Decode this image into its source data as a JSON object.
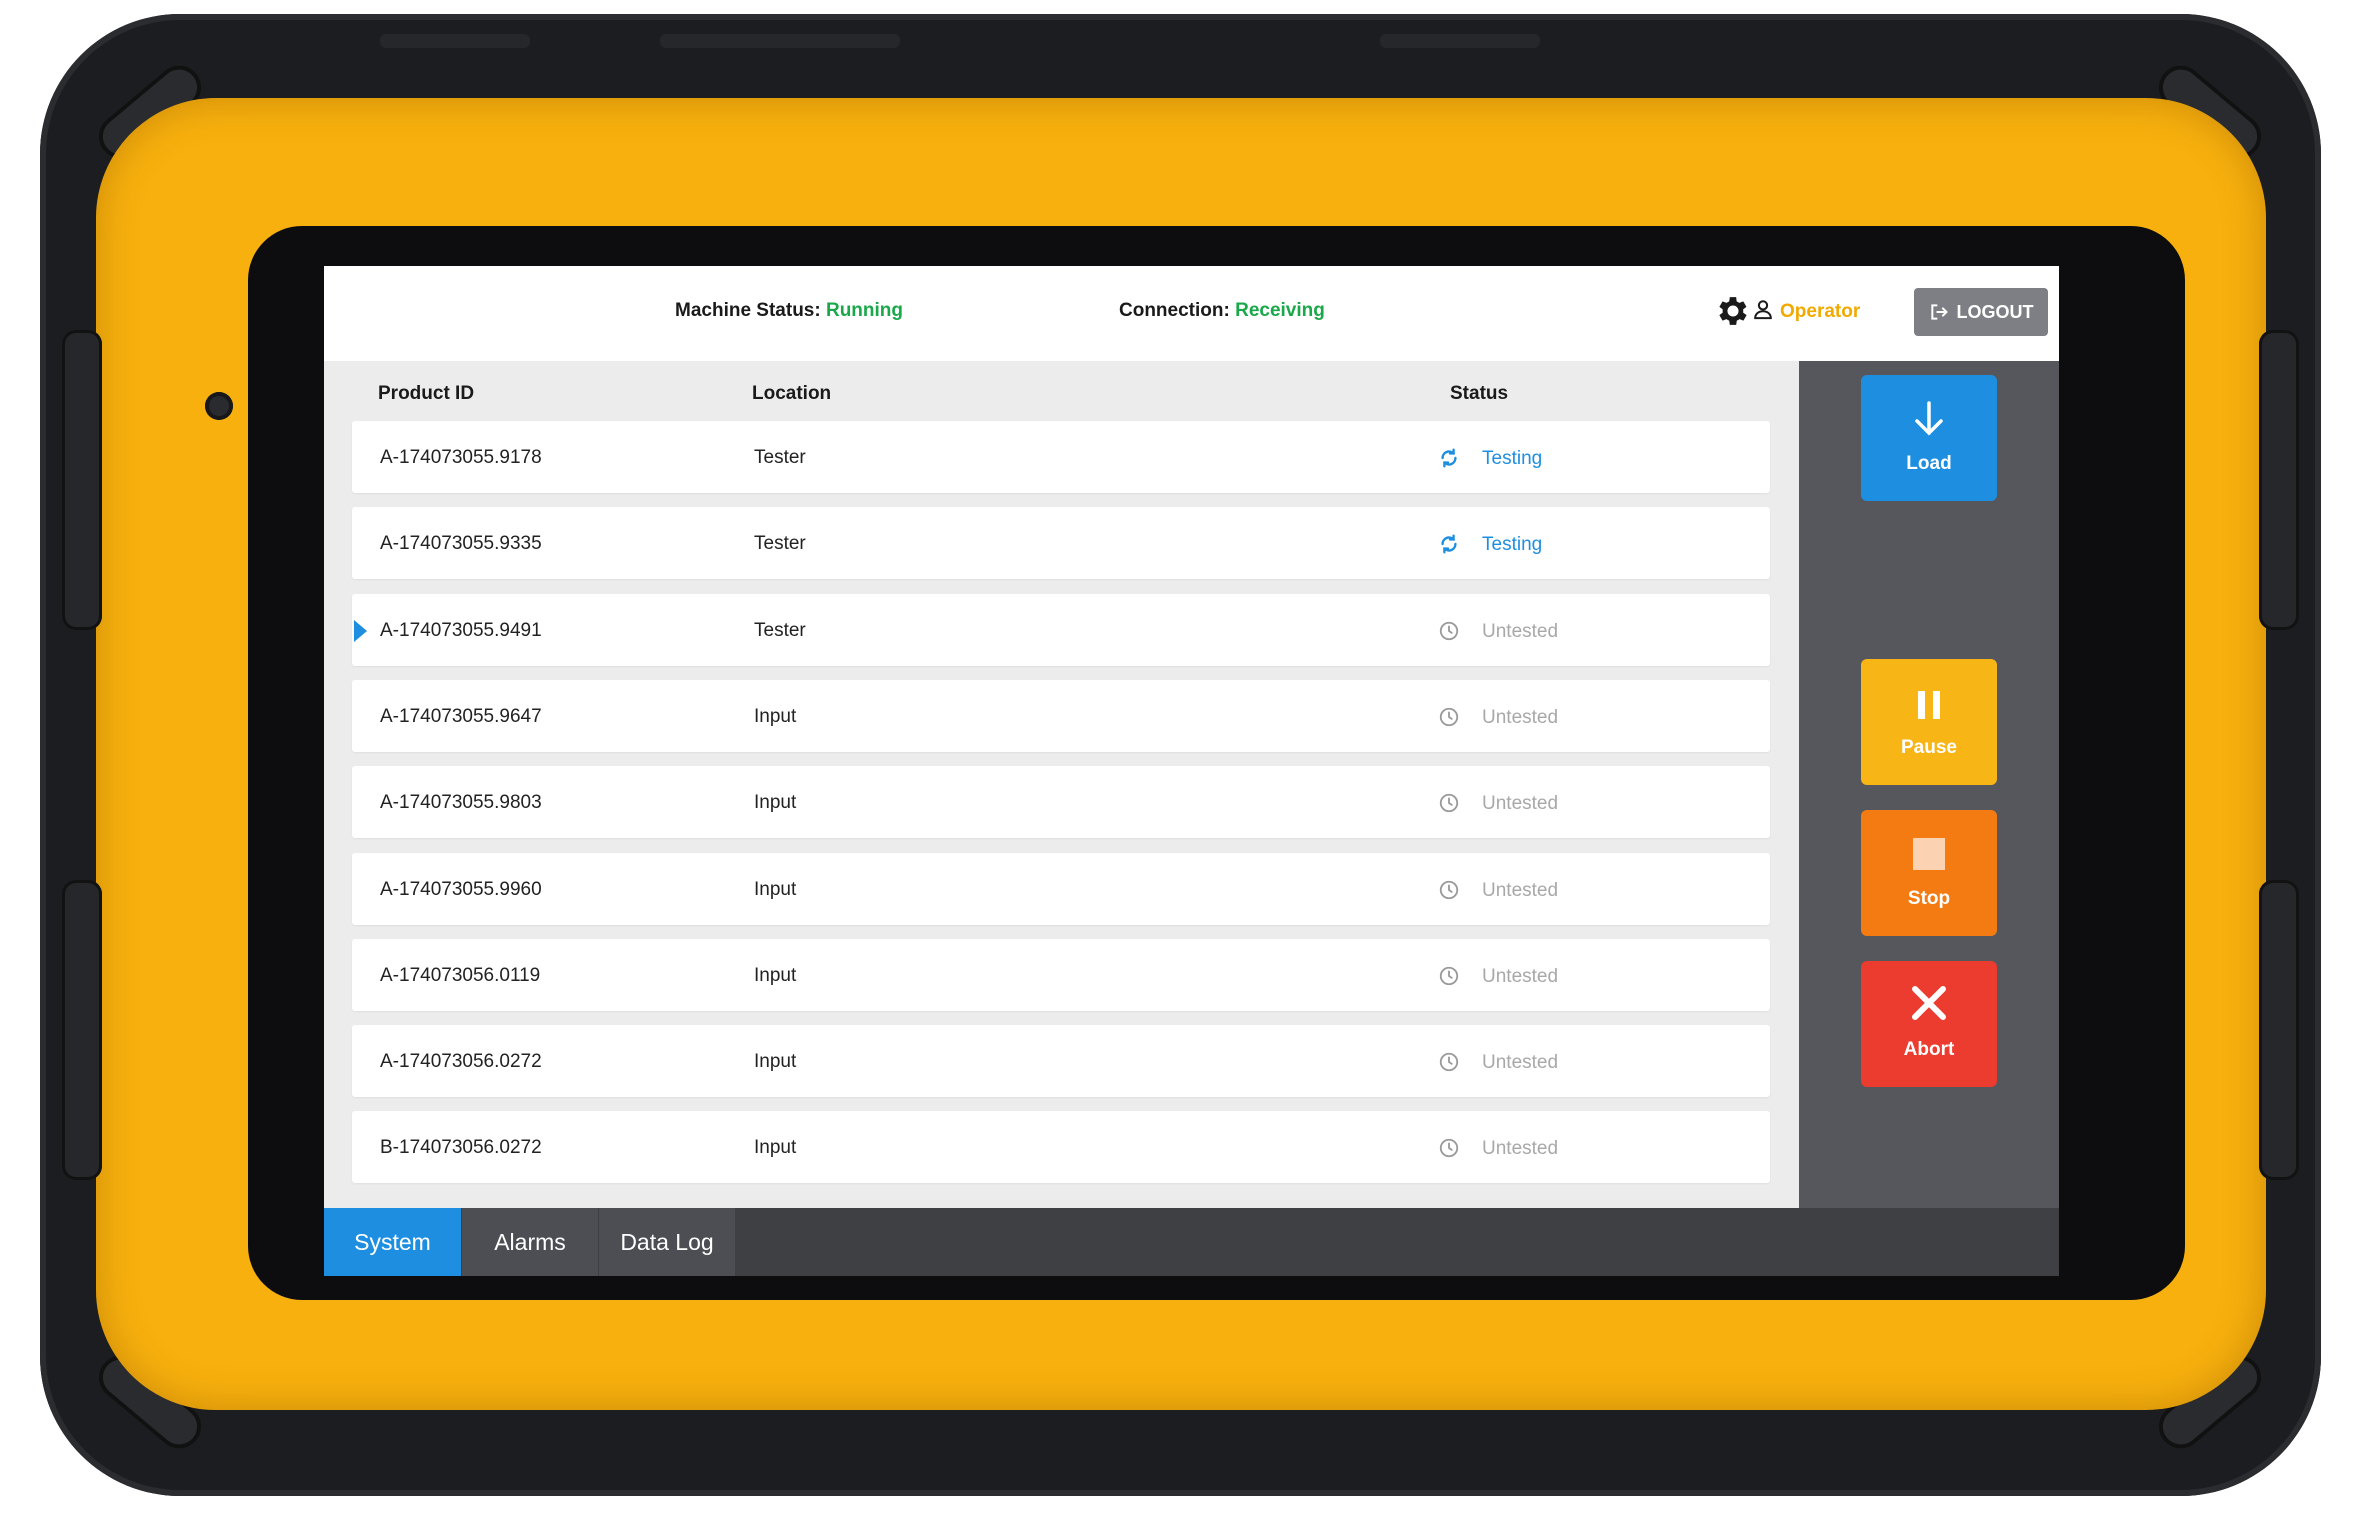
{
  "header": {
    "machine_status_label": "Machine Status:",
    "machine_status_value": "Running",
    "connection_label": "Connection:",
    "connection_value": "Receiving",
    "settings_icon": "gear-icon",
    "user_icon": "user-icon",
    "user_role": "Operator",
    "logout_label": "LOGOUT"
  },
  "table": {
    "columns": [
      "Product ID",
      "Location",
      "Status"
    ],
    "rows": [
      {
        "product_id": "A-174073055.9178",
        "location": "Tester",
        "status": "Testing"
      },
      {
        "product_id": "A-174073055.9335",
        "location": "Tester",
        "status": "Testing"
      },
      {
        "product_id": "A-174073055.9491",
        "location": "Tester",
        "status": "Untested"
      },
      {
        "product_id": "A-174073055.9647",
        "location": "Input",
        "status": "Untested"
      },
      {
        "product_id": "A-174073055.9803",
        "location": "Input",
        "status": "Untested"
      },
      {
        "product_id": "A-174073055.9960",
        "location": "Input",
        "status": "Untested"
      },
      {
        "product_id": "A-174073056.0119",
        "location": "Input",
        "status": "Untested"
      },
      {
        "product_id": "A-174073056.0272",
        "location": "Input",
        "status": "Untested"
      },
      {
        "product_id": "B-174073056.0272",
        "location": "Input",
        "status": "Untested"
      }
    ]
  },
  "actions": {
    "load": "Load",
    "pause": "Pause",
    "stop": "Stop",
    "abort": "Abort"
  },
  "tabs": [
    "System",
    "Alarms",
    "Data Log"
  ],
  "colors": {
    "accent_blue": "#1e8fe0",
    "running_green": "#1aa84a",
    "operator_amber": "#f2a900",
    "pause_yellow": "#f7b516",
    "stop_orange": "#f47b12",
    "abort_red": "#ec3b2f"
  }
}
